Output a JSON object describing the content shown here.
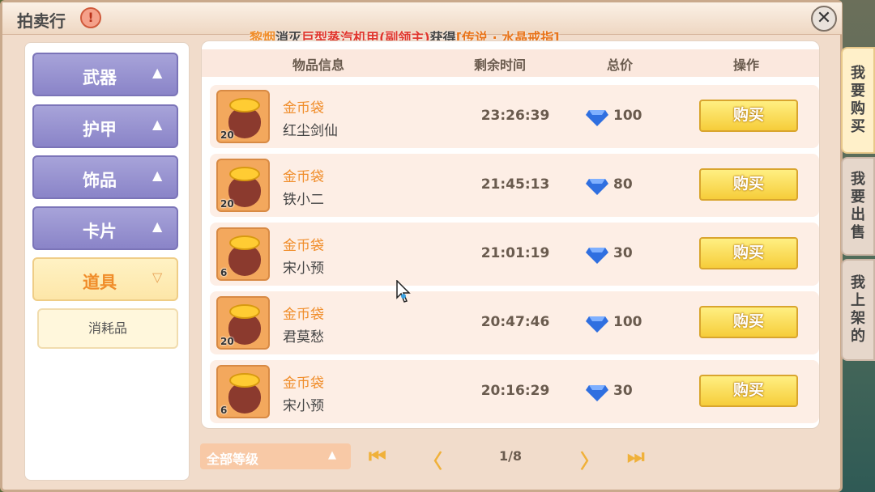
{
  "window": {
    "title": "拍卖行",
    "close": "✕",
    "info": "!"
  },
  "ticker": {
    "player": "黎烟",
    "verb": "消灭",
    "boss": "巨型蒸汽机甲(副领主)",
    "get": "获得",
    "item": "[传说 · 水晶戒指]"
  },
  "sidebar": {
    "categories": [
      {
        "label": "武器",
        "arrow": "▲"
      },
      {
        "label": "护甲",
        "arrow": "▲"
      },
      {
        "label": "饰品",
        "arrow": "▲"
      },
      {
        "label": "卡片",
        "arrow": "▲"
      },
      {
        "label": "道具",
        "arrow": "▽"
      }
    ],
    "sub_item": "消耗品"
  },
  "table": {
    "headers": {
      "item_info": "物品信息",
      "time_left": "剩余时间",
      "total_price": "总价",
      "action": "操作"
    },
    "rows": [
      {
        "item": "金币袋",
        "qty": "20",
        "seller": "红尘剑仙",
        "time": "23:26:39",
        "price": "100",
        "buy": "购买"
      },
      {
        "item": "金币袋",
        "qty": "20",
        "seller": "铁小二",
        "time": "21:45:13",
        "price": "80",
        "buy": "购买"
      },
      {
        "item": "金币袋",
        "qty": "6",
        "seller": "宋小预",
        "time": "21:01:19",
        "price": "30",
        "buy": "购买"
      },
      {
        "item": "金币袋",
        "qty": "20",
        "seller": "君莫愁",
        "time": "20:47:46",
        "price": "100",
        "buy": "购买"
      },
      {
        "item": "金币袋",
        "qty": "6",
        "seller": "宋小预",
        "time": "20:16:29",
        "price": "30",
        "buy": "购买"
      }
    ]
  },
  "footer": {
    "level_filter": "全部等级",
    "level_arrow": "▲",
    "first_page": "⏮",
    "prev_page": "〈",
    "page_indicator": "1/8",
    "next_page": "〉",
    "last_page": "⏭"
  },
  "side_tabs": [
    {
      "label": [
        "我",
        "要",
        "购",
        "买"
      ]
    },
    {
      "label": [
        "我",
        "要",
        "出",
        "售"
      ]
    },
    {
      "label": [
        "我",
        "上",
        "架",
        "的"
      ]
    }
  ],
  "colors": {
    "accent_orange": "#f08d2a",
    "sidebar_purple": "#8a84c8",
    "buy_yellow": "#f6cd3a",
    "gem_blue": "#2f6fe0"
  }
}
